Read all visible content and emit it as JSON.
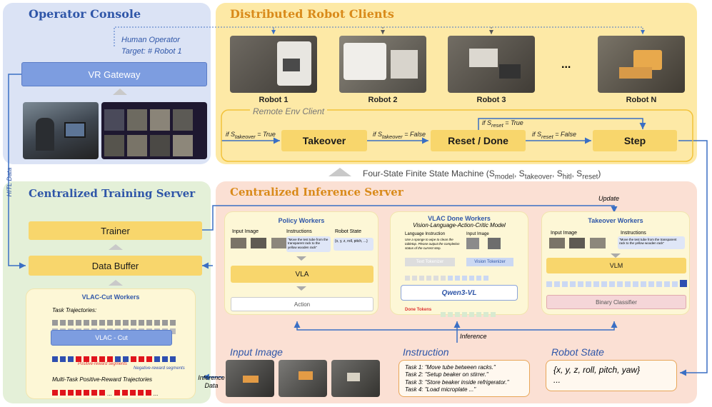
{
  "operator_console": {
    "title": "Operator Console",
    "human_operator": "Human Operator",
    "target": "Target: # Robot 1",
    "vr_gateway": "VR Gateway"
  },
  "robot_clients": {
    "title": "Distributed Robot Clients",
    "robots": [
      "Robot 1",
      "Robot 2",
      "Robot 3",
      "Robot N"
    ],
    "ellipsis": "...",
    "remote_env_client": "Remote Env Client",
    "states": {
      "takeover": "Takeover",
      "reset_done": "Reset / Done",
      "step": "Step"
    }
  },
  "fsm_label": "Four-State Finite State Machine",
  "hitl_data": "HITL Data",
  "training_server": {
    "title": "Centralized Training Server",
    "trainer": "Trainer",
    "data_buffer": "Data Buffer",
    "vlac_cut_workers": "VLAC-Cut Workers",
    "task_trajectories": "Task Trajectories:",
    "vlac_cut": "VLAC - Cut",
    "positive_segments": "Positive-reward segments",
    "negative_segments": "Negative-reward segments",
    "multi_task": "Multi-Task Positive-Reward Trajectories",
    "ellipsis": "..."
  },
  "inference_server": {
    "title": "Centralized Inference Server",
    "update": "Update",
    "inference": "Inference",
    "inference_data": "Inference Data",
    "policy_workers": {
      "title": "Policy Workers",
      "input_image": "Input Image",
      "instructions": "Instructions",
      "robot_state": "Robot State",
      "instruction_text": "\"Move the test tube from the transparent rack to the yellow wooden rack\"",
      "state_text": "{x, y, z, roll, pitch, ...}",
      "vla": "VLA",
      "action": "Action"
    },
    "vlac_done_workers": {
      "title": "VLAC Done Workers",
      "subtitle": "Vision-Language-Action-Critic Model",
      "language_instruction": "Language Instruction",
      "input_image": "Input Image",
      "instruction_text": "Use a sponge to wipe to clean the tabletop. Please output the completion status of the current step.",
      "text_tokenizer": "Text Tokenizer",
      "vision_tokenizer": "Vision Tokenizer",
      "model": "Qwen3-VL",
      "done_tokens": "Done Tokens"
    },
    "takeover_workers": {
      "title": "Takeover Workers",
      "input_image": "Input Image",
      "instructions": "Instructions",
      "instruction_text": "\"Move the test tube from the transparent rack to the yellow wooden rack\"",
      "vlm": "VLM",
      "binary_classifier": "Binary Classifier"
    },
    "input_image_title": "Input Image",
    "instruction_title": "Instruction",
    "robot_state_title": "Robot State",
    "tasks": [
      "Task 1: \"Move tube between racks.\"",
      "Task 2: \"Setup beaker on stirrer.\"",
      "Task 3: \"Store beaker inside refrigerator.\"",
      "Task 4: \"Load microplate ...\""
    ],
    "robot_state_text": "{x, y, z, roll, pitch, yaw}",
    "robot_state_ellipsis": "..."
  },
  "colors": {
    "blue_panel": "#dbe3f5",
    "yellow_panel": "#fde9a6",
    "green_panel": "#e4f0d8",
    "pink_panel": "#fbe0d4",
    "yellow_box": "#f8d66c",
    "title_blue": "#2f56a8"
  }
}
